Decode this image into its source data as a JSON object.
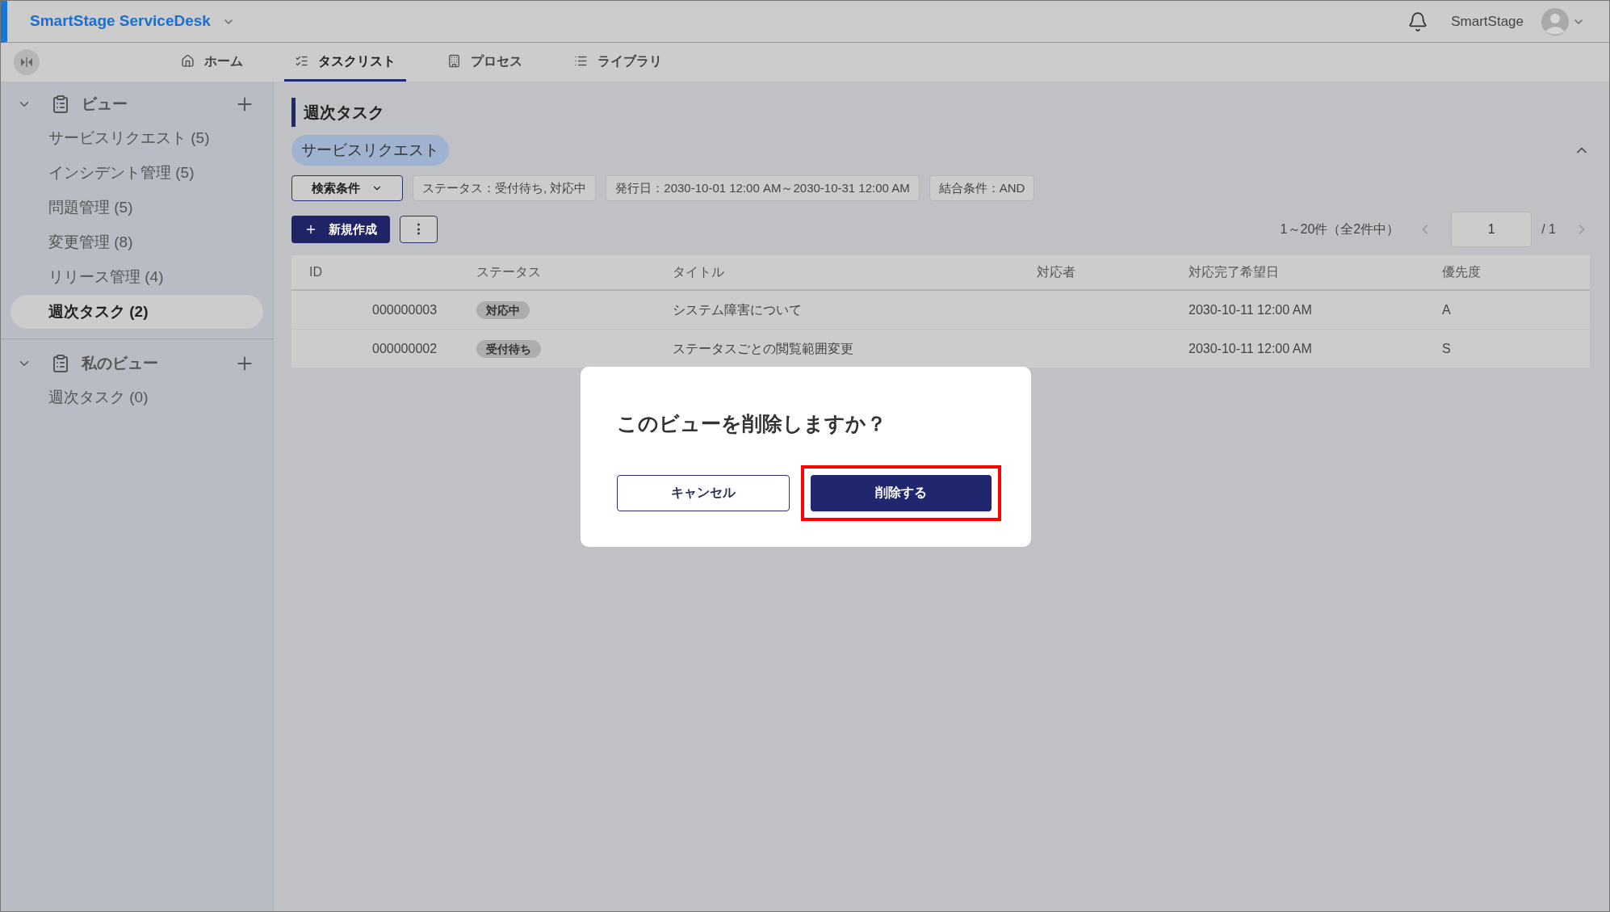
{
  "app": {
    "title": "SmartStage ServiceDesk",
    "user": "SmartStage"
  },
  "tabs": [
    {
      "label": "ホーム",
      "selected": false
    },
    {
      "label": "タスクリスト",
      "selected": true
    },
    {
      "label": "プロセス",
      "selected": false
    },
    {
      "label": "ライブラリ",
      "selected": false
    }
  ],
  "sidebar": {
    "sections": [
      {
        "title": "ビュー",
        "expanded": true,
        "items": [
          {
            "label": "サービスリクエスト (5)",
            "selected": false
          },
          {
            "label": "インシデント管理 (5)",
            "selected": false
          },
          {
            "label": "問題管理 (5)",
            "selected": false
          },
          {
            "label": "変更管理 (8)",
            "selected": false
          },
          {
            "label": "リリース管理 (4)",
            "selected": false
          },
          {
            "label": "週次タスク (2)",
            "selected": true
          }
        ]
      },
      {
        "title": "私のビュー",
        "expanded": true,
        "items": [
          {
            "label": "週次タスク (0)",
            "selected": false
          }
        ]
      }
    ]
  },
  "view": {
    "title": "週次タスク",
    "category": "サービスリクエスト",
    "filter_button": "検索条件",
    "filters": [
      "ステータス：受付待ち, 対応中",
      "発行日：2030-10-01 12:00 AM～2030-10-31 12:00 AM",
      "結合条件：AND"
    ],
    "new_button": "新規作成",
    "more_button": "⋮",
    "pagination": {
      "range": "1～20件（全2件中）",
      "page": "1",
      "total": "/ 1"
    },
    "table": {
      "columns": [
        "ID",
        "ステータス",
        "タイトル",
        "対応者",
        "対応完了希望日",
        "優先度"
      ],
      "rows": [
        {
          "id": "000000003",
          "status": "対応中",
          "title": "システム障害について",
          "due": "2030-10-11 12:00 AM",
          "priority": "A"
        },
        {
          "id": "000000002",
          "status": "受付待ち",
          "title": "ステータスごとの閲覧範囲変更",
          "due": "2030-10-11 12:00 AM",
          "priority": "S"
        }
      ]
    }
  },
  "dialog": {
    "message": "このビューを削除しますか？",
    "cancel": "キャンセル",
    "confirm": "削除する",
    "confirm_highlighted": true
  }
}
